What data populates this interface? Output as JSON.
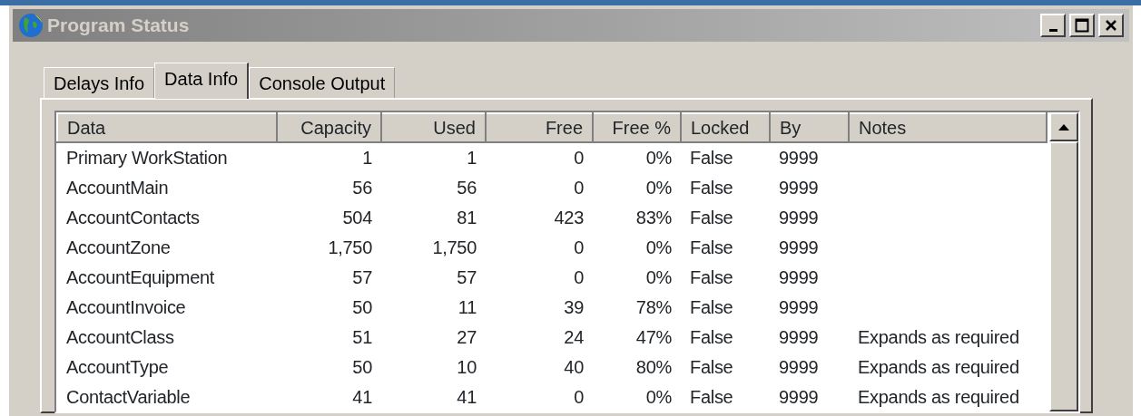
{
  "window": {
    "title": "Program Status"
  },
  "tabs": [
    {
      "label": "Delays Info",
      "selected": false
    },
    {
      "label": "Data Info",
      "selected": true
    },
    {
      "label": "Console Output",
      "selected": false
    }
  ],
  "table": {
    "columns": [
      {
        "label": "Data",
        "kind": "text"
      },
      {
        "label": "Capacity",
        "kind": "number"
      },
      {
        "label": "Used",
        "kind": "number"
      },
      {
        "label": "Free",
        "kind": "number"
      },
      {
        "label": "Free %",
        "kind": "number"
      },
      {
        "label": "Locked",
        "kind": "text"
      },
      {
        "label": "By",
        "kind": "text"
      },
      {
        "label": "Notes",
        "kind": "text"
      }
    ],
    "rows": [
      [
        "Primary WorkStation",
        "1",
        "1",
        "0",
        "0%",
        "False",
        "9999",
        ""
      ],
      [
        "AccountMain",
        "56",
        "56",
        "0",
        "0%",
        "False",
        "9999",
        ""
      ],
      [
        "AccountContacts",
        "504",
        "81",
        "423",
        "83%",
        "False",
        "9999",
        ""
      ],
      [
        "AccountZone",
        "1,750",
        "1,750",
        "0",
        "0%",
        "False",
        "9999",
        ""
      ],
      [
        "AccountEquipment",
        "57",
        "57",
        "0",
        "0%",
        "False",
        "9999",
        ""
      ],
      [
        "AccountInvoice",
        "50",
        "11",
        "39",
        "78%",
        "False",
        "9999",
        ""
      ],
      [
        "AccountClass",
        "51",
        "27",
        "24",
        "47%",
        "False",
        "9999",
        "Expands as required"
      ],
      [
        "AccountType",
        "50",
        "10",
        "40",
        "80%",
        "False",
        "9999",
        "Expands as required"
      ],
      [
        "ContactVariable",
        "41",
        "41",
        "0",
        "0%",
        "False",
        "9999",
        "Expands as required"
      ]
    ]
  }
}
